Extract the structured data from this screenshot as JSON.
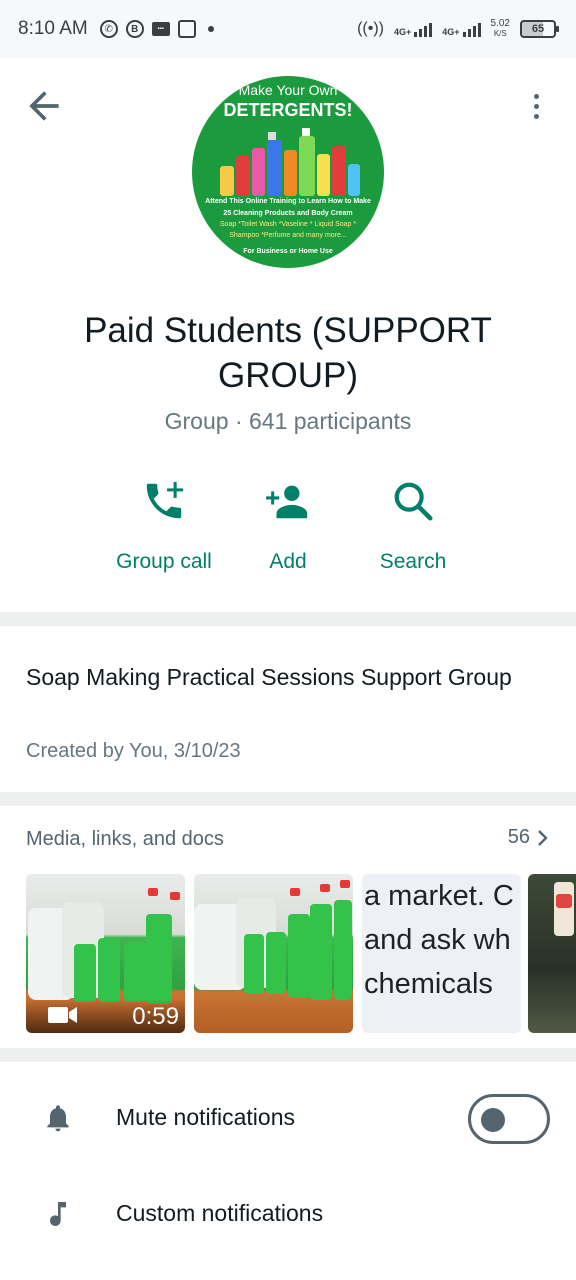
{
  "status_bar": {
    "time": "8:10 AM",
    "speed_value": "5.02",
    "speed_unit": "K/S",
    "battery": "65",
    "net1": "4G+",
    "net2": "4G+"
  },
  "avatar": {
    "line1": "Make Your Own",
    "line2": "DETERGENTS!",
    "line3": "Attend This Online Training to Learn How to Make",
    "line4": "25 Cleaning Products and Body Cream",
    "line5": "Soap *Toilet Wash *Vaseline * Liquid Soap *",
    "line6": "Shampoo *Perfume and many more...",
    "line7": "For Business or Home Use"
  },
  "group": {
    "name": "Paid Students (SUPPORT GROUP)",
    "meta": "Group · 641 participants"
  },
  "actions": [
    {
      "label": "Group call",
      "icon": "group-call-icon"
    },
    {
      "label": "Add",
      "icon": "add-participant-icon"
    },
    {
      "label": "Search",
      "icon": "search-icon"
    }
  ],
  "description": {
    "text": "Soap Making Practical Sessions Support Group",
    "created": "Created by You, 3/10/23"
  },
  "media": {
    "title": "Media, links, and docs",
    "count": "56",
    "video_duration": "0:59",
    "text_thumb_lines": [
      "a market. C",
      "and ask wh",
      "chemicals"
    ]
  },
  "settings": {
    "mute_label": "Mute notifications",
    "custom_label": "Custom notifications",
    "mute_enabled": false
  },
  "colors": {
    "accent": "#008069",
    "secondary_text": "#667781",
    "icon": "#54656f"
  }
}
